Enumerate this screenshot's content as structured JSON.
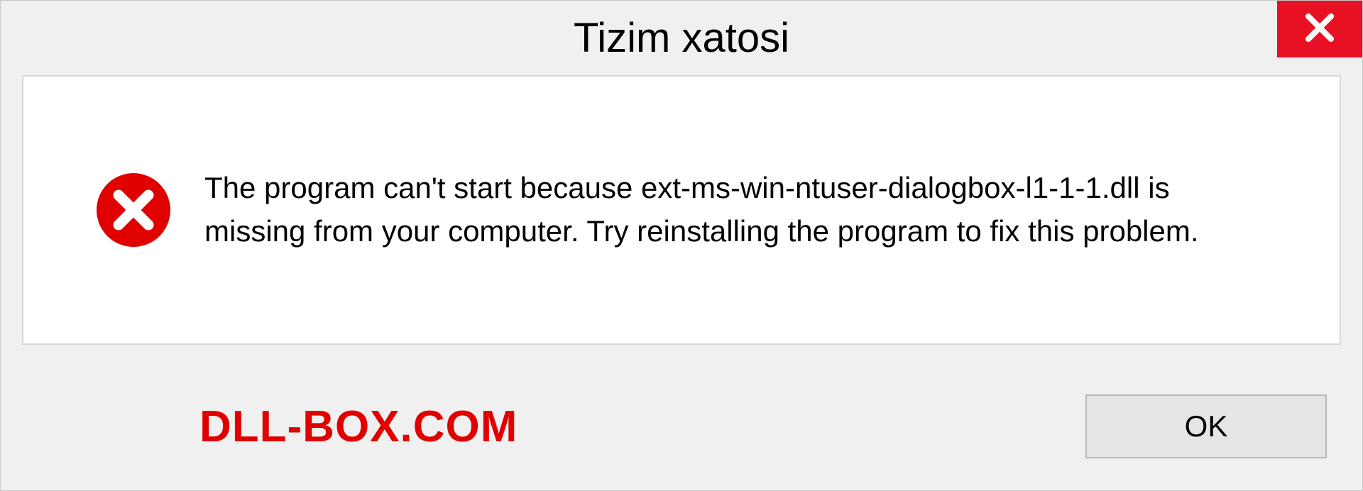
{
  "dialog": {
    "title": "Tizim xatosi",
    "message": "The program can't start because ext-ms-win-ntuser-dialogbox-l1-1-1.dll is missing from your computer. Try reinstalling the program to fix this problem.",
    "ok_label": "OK"
  },
  "watermark": "DLL-BOX.COM",
  "colors": {
    "close_bg": "#e81123",
    "error_icon": "#e00000",
    "watermark": "#e00000"
  }
}
